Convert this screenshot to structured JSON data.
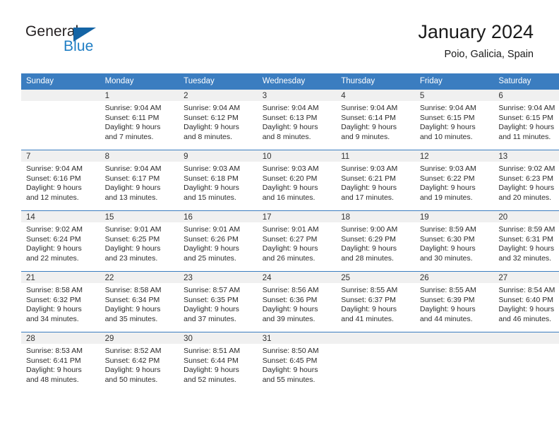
{
  "brand": {
    "name_primary": "General",
    "name_secondary": "Blue",
    "triangle_color": "#1464a5",
    "blue_text_color": "#1f7ec4"
  },
  "header": {
    "title": "January 2024",
    "location": "Poio, Galicia, Spain",
    "header_bg_color": "#3b7dc0"
  },
  "weekday_headers": [
    "Sunday",
    "Monday",
    "Tuesday",
    "Wednesday",
    "Thursday",
    "Friday",
    "Saturday"
  ],
  "weeks": [
    [
      {
        "day": "",
        "sunrise": "",
        "sunset": "",
        "daylight_line1": "",
        "daylight_line2": ""
      },
      {
        "day": "1",
        "sunrise": "Sunrise: 9:04 AM",
        "sunset": "Sunset: 6:11 PM",
        "daylight_line1": "Daylight: 9 hours",
        "daylight_line2": "and 7 minutes."
      },
      {
        "day": "2",
        "sunrise": "Sunrise: 9:04 AM",
        "sunset": "Sunset: 6:12 PM",
        "daylight_line1": "Daylight: 9 hours",
        "daylight_line2": "and 8 minutes."
      },
      {
        "day": "3",
        "sunrise": "Sunrise: 9:04 AM",
        "sunset": "Sunset: 6:13 PM",
        "daylight_line1": "Daylight: 9 hours",
        "daylight_line2": "and 8 minutes."
      },
      {
        "day": "4",
        "sunrise": "Sunrise: 9:04 AM",
        "sunset": "Sunset: 6:14 PM",
        "daylight_line1": "Daylight: 9 hours",
        "daylight_line2": "and 9 minutes."
      },
      {
        "day": "5",
        "sunrise": "Sunrise: 9:04 AM",
        "sunset": "Sunset: 6:15 PM",
        "daylight_line1": "Daylight: 9 hours",
        "daylight_line2": "and 10 minutes."
      },
      {
        "day": "6",
        "sunrise": "Sunrise: 9:04 AM",
        "sunset": "Sunset: 6:15 PM",
        "daylight_line1": "Daylight: 9 hours",
        "daylight_line2": "and 11 minutes."
      }
    ],
    [
      {
        "day": "7",
        "sunrise": "Sunrise: 9:04 AM",
        "sunset": "Sunset: 6:16 PM",
        "daylight_line1": "Daylight: 9 hours",
        "daylight_line2": "and 12 minutes."
      },
      {
        "day": "8",
        "sunrise": "Sunrise: 9:04 AM",
        "sunset": "Sunset: 6:17 PM",
        "daylight_line1": "Daylight: 9 hours",
        "daylight_line2": "and 13 minutes."
      },
      {
        "day": "9",
        "sunrise": "Sunrise: 9:03 AM",
        "sunset": "Sunset: 6:18 PM",
        "daylight_line1": "Daylight: 9 hours",
        "daylight_line2": "and 15 minutes."
      },
      {
        "day": "10",
        "sunrise": "Sunrise: 9:03 AM",
        "sunset": "Sunset: 6:20 PM",
        "daylight_line1": "Daylight: 9 hours",
        "daylight_line2": "and 16 minutes."
      },
      {
        "day": "11",
        "sunrise": "Sunrise: 9:03 AM",
        "sunset": "Sunset: 6:21 PM",
        "daylight_line1": "Daylight: 9 hours",
        "daylight_line2": "and 17 minutes."
      },
      {
        "day": "12",
        "sunrise": "Sunrise: 9:03 AM",
        "sunset": "Sunset: 6:22 PM",
        "daylight_line1": "Daylight: 9 hours",
        "daylight_line2": "and 19 minutes."
      },
      {
        "day": "13",
        "sunrise": "Sunrise: 9:02 AM",
        "sunset": "Sunset: 6:23 PM",
        "daylight_line1": "Daylight: 9 hours",
        "daylight_line2": "and 20 minutes."
      }
    ],
    [
      {
        "day": "14",
        "sunrise": "Sunrise: 9:02 AM",
        "sunset": "Sunset: 6:24 PM",
        "daylight_line1": "Daylight: 9 hours",
        "daylight_line2": "and 22 minutes."
      },
      {
        "day": "15",
        "sunrise": "Sunrise: 9:01 AM",
        "sunset": "Sunset: 6:25 PM",
        "daylight_line1": "Daylight: 9 hours",
        "daylight_line2": "and 23 minutes."
      },
      {
        "day": "16",
        "sunrise": "Sunrise: 9:01 AM",
        "sunset": "Sunset: 6:26 PM",
        "daylight_line1": "Daylight: 9 hours",
        "daylight_line2": "and 25 minutes."
      },
      {
        "day": "17",
        "sunrise": "Sunrise: 9:01 AM",
        "sunset": "Sunset: 6:27 PM",
        "daylight_line1": "Daylight: 9 hours",
        "daylight_line2": "and 26 minutes."
      },
      {
        "day": "18",
        "sunrise": "Sunrise: 9:00 AM",
        "sunset": "Sunset: 6:29 PM",
        "daylight_line1": "Daylight: 9 hours",
        "daylight_line2": "and 28 minutes."
      },
      {
        "day": "19",
        "sunrise": "Sunrise: 8:59 AM",
        "sunset": "Sunset: 6:30 PM",
        "daylight_line1": "Daylight: 9 hours",
        "daylight_line2": "and 30 minutes."
      },
      {
        "day": "20",
        "sunrise": "Sunrise: 8:59 AM",
        "sunset": "Sunset: 6:31 PM",
        "daylight_line1": "Daylight: 9 hours",
        "daylight_line2": "and 32 minutes."
      }
    ],
    [
      {
        "day": "21",
        "sunrise": "Sunrise: 8:58 AM",
        "sunset": "Sunset: 6:32 PM",
        "daylight_line1": "Daylight: 9 hours",
        "daylight_line2": "and 34 minutes."
      },
      {
        "day": "22",
        "sunrise": "Sunrise: 8:58 AM",
        "sunset": "Sunset: 6:34 PM",
        "daylight_line1": "Daylight: 9 hours",
        "daylight_line2": "and 35 minutes."
      },
      {
        "day": "23",
        "sunrise": "Sunrise: 8:57 AM",
        "sunset": "Sunset: 6:35 PM",
        "daylight_line1": "Daylight: 9 hours",
        "daylight_line2": "and 37 minutes."
      },
      {
        "day": "24",
        "sunrise": "Sunrise: 8:56 AM",
        "sunset": "Sunset: 6:36 PM",
        "daylight_line1": "Daylight: 9 hours",
        "daylight_line2": "and 39 minutes."
      },
      {
        "day": "25",
        "sunrise": "Sunrise: 8:55 AM",
        "sunset": "Sunset: 6:37 PM",
        "daylight_line1": "Daylight: 9 hours",
        "daylight_line2": "and 41 minutes."
      },
      {
        "day": "26",
        "sunrise": "Sunrise: 8:55 AM",
        "sunset": "Sunset: 6:39 PM",
        "daylight_line1": "Daylight: 9 hours",
        "daylight_line2": "and 44 minutes."
      },
      {
        "day": "27",
        "sunrise": "Sunrise: 8:54 AM",
        "sunset": "Sunset: 6:40 PM",
        "daylight_line1": "Daylight: 9 hours",
        "daylight_line2": "and 46 minutes."
      }
    ],
    [
      {
        "day": "28",
        "sunrise": "Sunrise: 8:53 AM",
        "sunset": "Sunset: 6:41 PM",
        "daylight_line1": "Daylight: 9 hours",
        "daylight_line2": "and 48 minutes."
      },
      {
        "day": "29",
        "sunrise": "Sunrise: 8:52 AM",
        "sunset": "Sunset: 6:42 PM",
        "daylight_line1": "Daylight: 9 hours",
        "daylight_line2": "and 50 minutes."
      },
      {
        "day": "30",
        "sunrise": "Sunrise: 8:51 AM",
        "sunset": "Sunset: 6:44 PM",
        "daylight_line1": "Daylight: 9 hours",
        "daylight_line2": "and 52 minutes."
      },
      {
        "day": "31",
        "sunrise": "Sunrise: 8:50 AM",
        "sunset": "Sunset: 6:45 PM",
        "daylight_line1": "Daylight: 9 hours",
        "daylight_line2": "and 55 minutes."
      },
      {
        "day": "",
        "sunrise": "",
        "sunset": "",
        "daylight_line1": "",
        "daylight_line2": ""
      },
      {
        "day": "",
        "sunrise": "",
        "sunset": "",
        "daylight_line1": "",
        "daylight_line2": ""
      },
      {
        "day": "",
        "sunrise": "",
        "sunset": "",
        "daylight_line1": "",
        "daylight_line2": ""
      }
    ]
  ]
}
